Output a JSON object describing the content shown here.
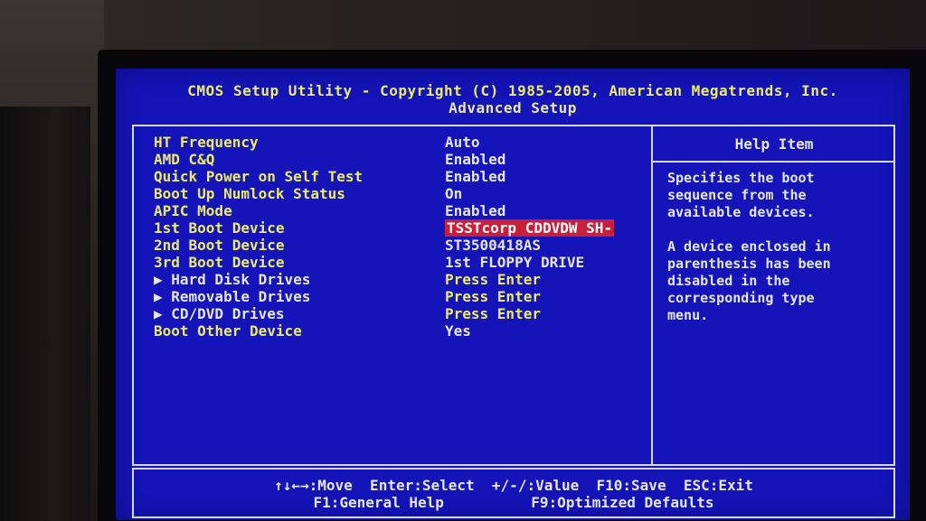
{
  "header": {
    "line1": "CMOS Setup Utility - Copyright (C) 1985-2005, American Megatrends, Inc.",
    "line2": "Advanced Setup"
  },
  "settings": [
    {
      "label": "HT Frequency",
      "value": "Auto"
    },
    {
      "label": "AMD C&Q",
      "value": "Enabled"
    },
    {
      "label": "Quick Power on Self Test",
      "value": "Enabled"
    },
    {
      "label": "Boot Up Numlock Status",
      "value": "On"
    },
    {
      "label": "APIC Mode",
      "value": "Enabled"
    },
    {
      "label": "1st Boot Device",
      "value": "TSSTcorp CDDVDW SH-"
    },
    {
      "label": "2nd Boot Device",
      "value": "ST3500418AS"
    },
    {
      "label": "3rd Boot Device",
      "value": "1st FLOPPY DRIVE"
    },
    {
      "label": "▶ Hard Disk Drives",
      "value": "Press Enter"
    },
    {
      "label": "▶ Removable Drives",
      "value": "Press Enter"
    },
    {
      "label": "▶ CD/DVD Drives",
      "value": "Press Enter"
    },
    {
      "label": "Boot Other Device",
      "value": "Yes"
    }
  ],
  "help": {
    "title": "Help Item",
    "text": "Specifies the boot\nsequence from the\navailable devices.\n\nA device enclosed in\nparenthesis has been\ndisabled in the\ncorresponding type\nmenu."
  },
  "footer": {
    "line1": "↑↓←→:Move  Enter:Select  +/-/:Value  F10:Save  ESC:Exit",
    "line2": "F1:General Help          F9:Optimized Defaults"
  },
  "colors": {
    "background": "#1414b8",
    "label": "#ecec6a",
    "value": "#e6e6f0",
    "selected": "#c8203a"
  }
}
